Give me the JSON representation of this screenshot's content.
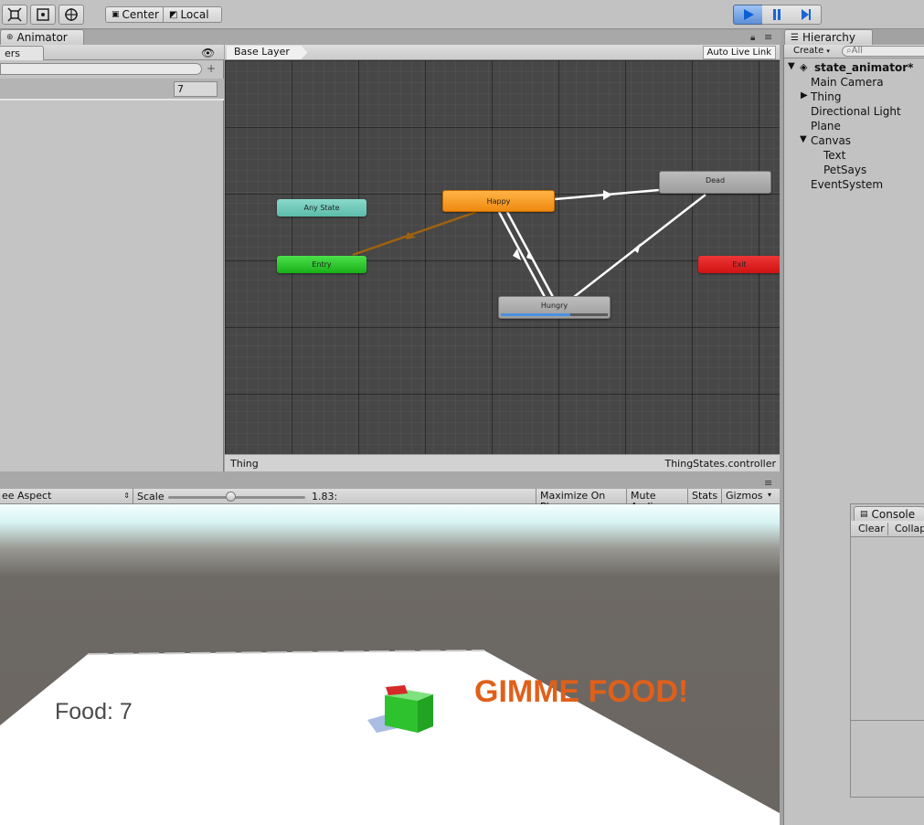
{
  "toolbar": {
    "pivot_center": "Center",
    "pivot_local": "Local"
  },
  "animator": {
    "tab_label": "Animator",
    "left_tab_label": "ers",
    "param_value": "7",
    "layer_label": "Base Layer",
    "auto_live_link": "Auto Live Link",
    "footer_object": "Thing",
    "footer_controller": "ThingStates.controller",
    "states": {
      "any_state": "Any State",
      "entry": "Entry",
      "happy": "Happy",
      "dead": "Dead",
      "hungry": "Hungry",
      "exit": "Exit"
    },
    "hungry_progress": 0.65,
    "colors": {
      "any_state": "#6dc9b8",
      "entry": "#27c227",
      "happy": "#f39a1a",
      "dead": "#a9a9a9",
      "hungry": "#a9a9a9",
      "exit": "#e41a1a",
      "transition": "#ffffff",
      "entry_transition": "#a0620e",
      "progress": "#4a90e2"
    }
  },
  "game_bar": {
    "aspect": "ee Aspect",
    "scale_label": "Scale",
    "scale_value": "1.83:",
    "scale_slider": 0.45,
    "maximize": "Maximize On Play",
    "mute": "Mute Audio",
    "stats": "Stats",
    "gizmos": "Gizmos"
  },
  "game": {
    "food_text": "Food: 7",
    "pet_says": "GIMME FOOD!",
    "pet_says_color": "#e0601a"
  },
  "hierarchy": {
    "tab_label": "Hierarchy",
    "create_label": "Create",
    "search_placeholder": "All",
    "scene_name": "state_animator*",
    "items": [
      "Main Camera",
      "Thing",
      "Directional Light",
      "Plane",
      "Canvas",
      "Text",
      "PetSays",
      "EventSystem"
    ]
  },
  "console": {
    "tab_label": "Console",
    "clear": "Clear",
    "collapse": "Collap"
  }
}
